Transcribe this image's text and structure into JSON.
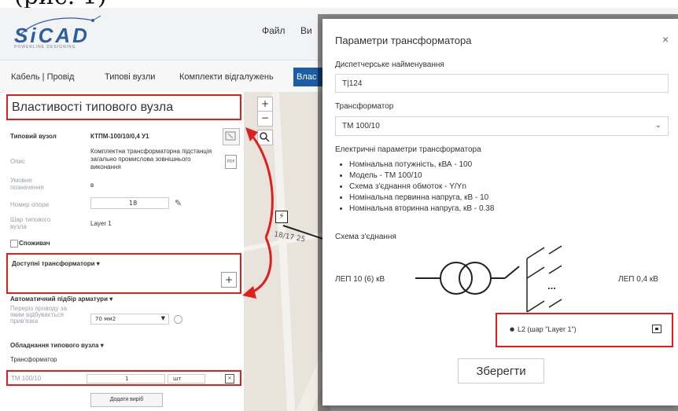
{
  "doc_fragment": "(рис. 1)",
  "header": {
    "logo_text": "SiCAD",
    "logo_subtitle": "POWERLINE DESIGNING",
    "menu": [
      "Файл",
      "Ви"
    ]
  },
  "tabs": {
    "items": [
      "Кабель | Провід",
      "Типові вузли",
      "Комплекти відгалужень"
    ],
    "active": "Влас"
  },
  "panel": {
    "title": "Властивості типового вузла",
    "typical_node_label": "Типовий вузол",
    "typical_node_value": "КТПМ-100/10/0,4 У1",
    "description_label": "Опис",
    "description_value": "Комплектна трансформаторна підстанція загально промислова зовнішнього виконання",
    "designation_label": "Умовне позначення",
    "designation_value": "в",
    "pole_label": "Номер опори",
    "pole_value": "18",
    "layer_label": "Шар типового вузла",
    "layer_value": "Layer 1",
    "consumer_label": "Споживач",
    "transformers_header": "Доступні трансформатори ▾",
    "auto_fitting_header": "Автоматичний підбір арматури ▾",
    "wire_section_label": "Переріз проводу за яким відбувається прив'язка",
    "wire_section_value": "70 мм2",
    "equipment_header": "Обладнання типового вузла ▾",
    "equipment_sub": "Трансформатор",
    "equipment_item": "ТМ 100/10",
    "equipment_qty": "1",
    "equipment_unit": "шт",
    "add_button": "Додати виріб"
  },
  "map": {
    "zoom_in": "+",
    "zoom_out": "−",
    "span_label": "18/17 25"
  },
  "modal": {
    "title": "Параметри трансформатора",
    "close": "×",
    "dispatch_label": "Диспетчерське найменування",
    "dispatch_value": "Т|124",
    "transformer_label": "Трансформатор",
    "transformer_value": "ТМ 100/10",
    "elec_params_title": "Електричні параметри трансформатора",
    "params": [
      "Номінальна потужність, кВА - 100",
      "Модель - ТМ 100/10",
      "Схема з'єднання обмоток - Y/Yn",
      "Номінальна первинна напруга, кВ - 10",
      "Номінальна вторинна напруга, кВ - 0.38"
    ],
    "scheme_label": "Схема з'єднання",
    "left_line": "ЛЕП 10 (6) кВ",
    "right_line": "ЛЕП 0,4 кВ",
    "ellipsis": "...",
    "line_item": "L2 (шар \"Layer 1\")",
    "save_button": "Зберегти"
  },
  "colors": {
    "accent": "#1b5ea6",
    "highlight": "#e11e1e",
    "logo": "#2d5fa0"
  }
}
